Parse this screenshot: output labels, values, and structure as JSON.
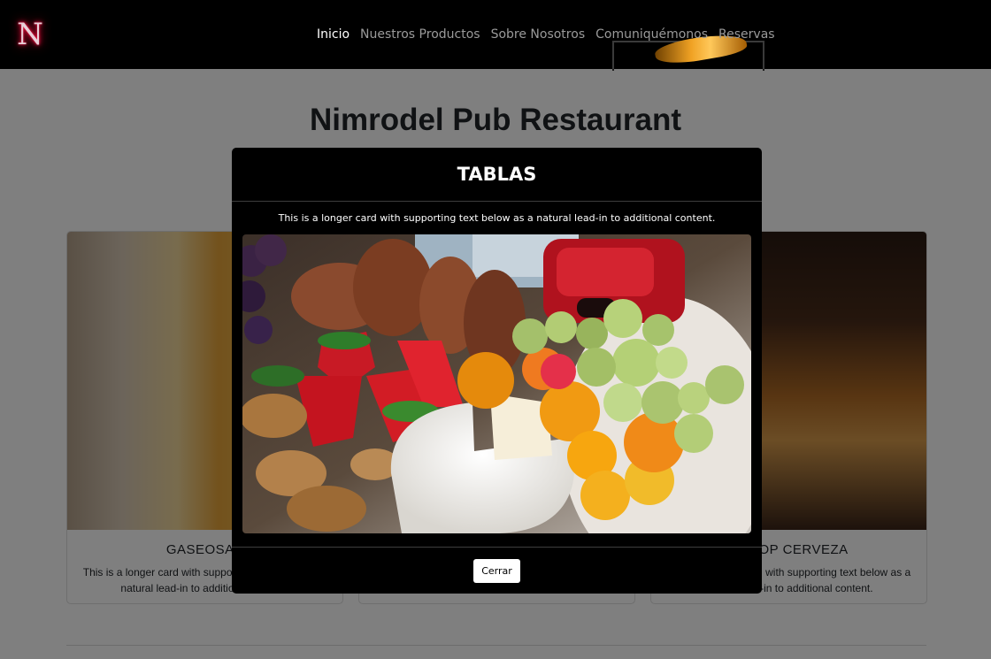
{
  "nav": {
    "logo_letter": "N",
    "links": [
      "Inicio",
      "Nuestros Productos",
      "Sobre Nosotros",
      "Comuniquémonos",
      "Reservas"
    ]
  },
  "page": {
    "title": "Nimrodel Pub Restaurant"
  },
  "cards": [
    {
      "title": "GASEOSAS",
      "text": "This is a longer card with supporting text below as a natural lead-in to additional content."
    },
    {
      "title": "",
      "text": ""
    },
    {
      "title": "SCHOP CERVEZA",
      "text": "This is a longer card with supporting text below as a natural lead-in to additional content."
    }
  ],
  "modal": {
    "title": "TABLAS",
    "text": "This is a longer card with supporting text below as a natural lead-in to additional content.",
    "image_subject": "cheese-board-photo",
    "close_label": "Cerrar"
  },
  "colors": {
    "navbar": "#000000",
    "logo_glow": "#ff1040",
    "modal_bg": "#000000",
    "backdrop": "rgba(0,0,0,0.5)"
  }
}
